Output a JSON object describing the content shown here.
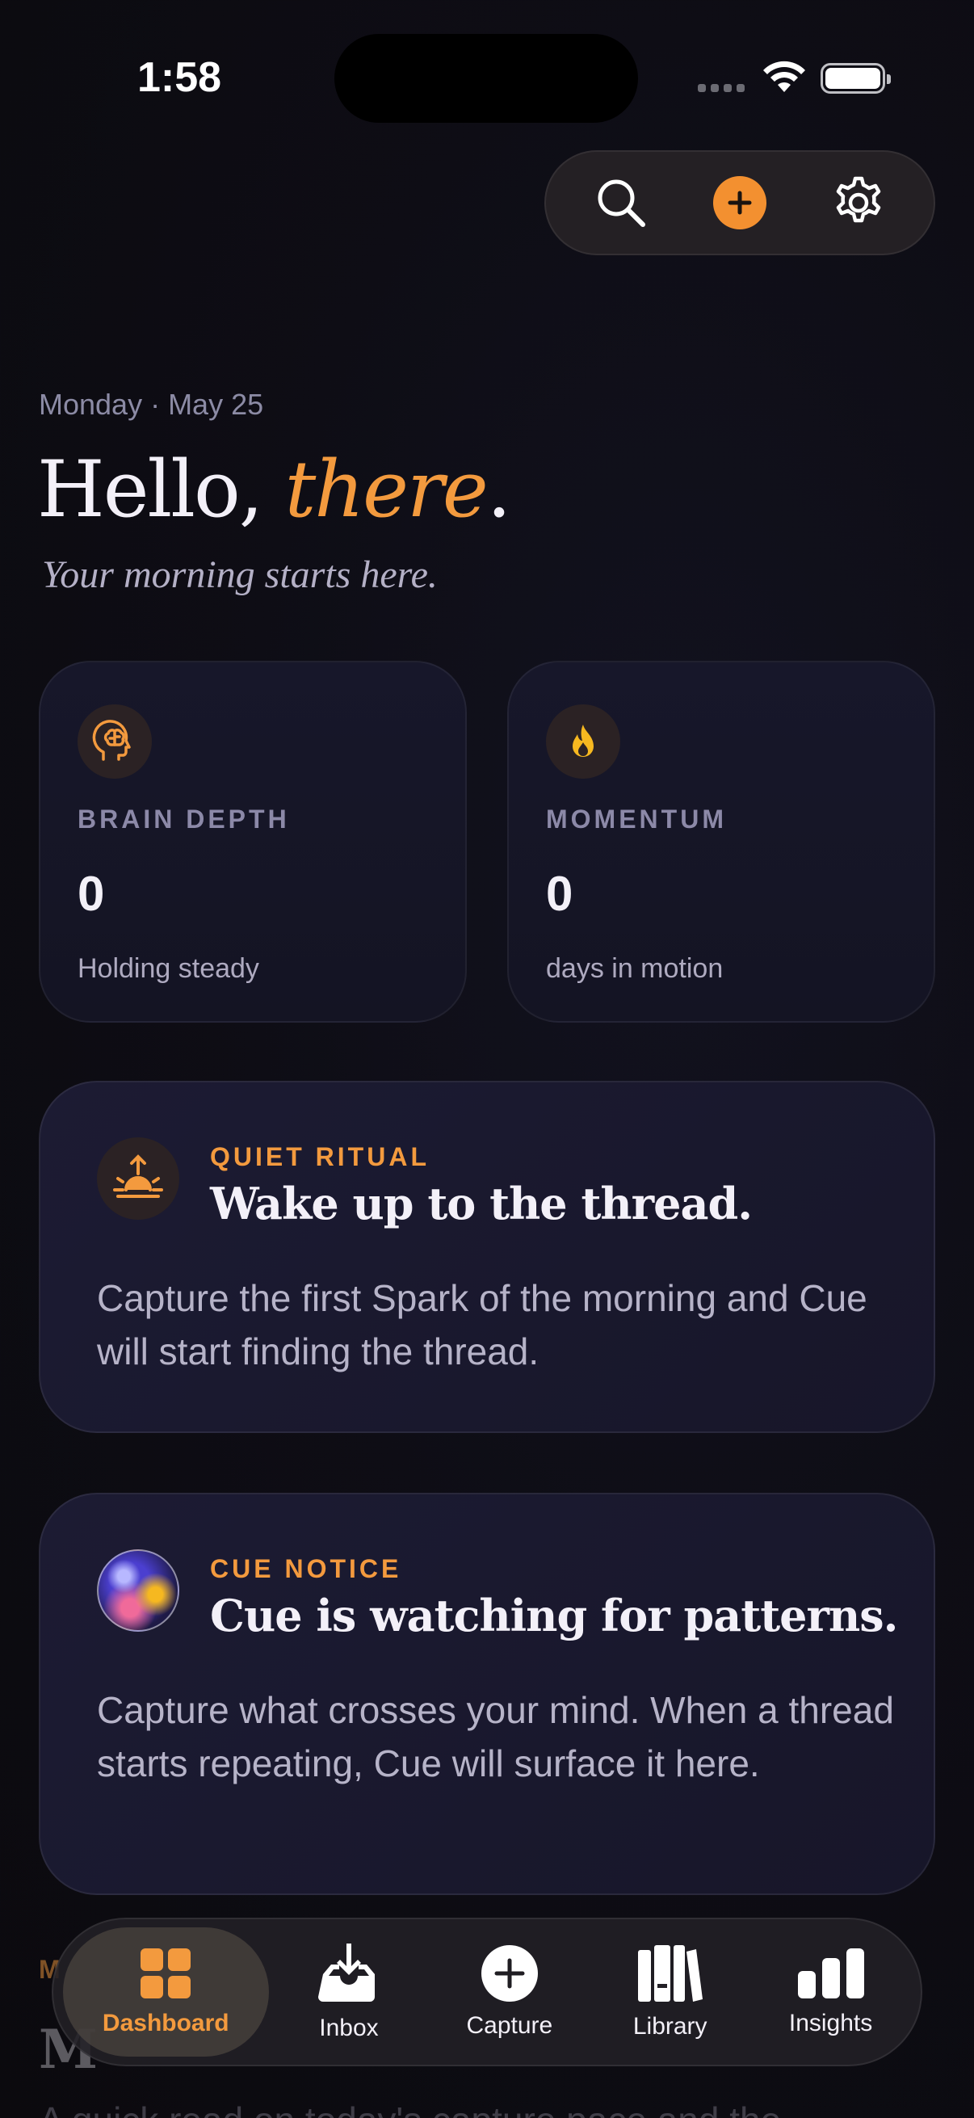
{
  "status": {
    "time": "1:58"
  },
  "toolbar": {
    "search_icon": "search-icon",
    "add_icon": "plus-icon",
    "settings_icon": "gear-icon"
  },
  "header": {
    "date": "Monday · May 25",
    "greeting_prefix": "Hello, ",
    "greeting_name": "there",
    "greeting_suffix": ".",
    "subtitle": "Your morning starts here."
  },
  "stats": [
    {
      "icon": "brain-icon",
      "label": "BRAIN DEPTH",
      "value": "0",
      "caption": "Holding steady"
    },
    {
      "icon": "flame-icon",
      "label": "MOMENTUM",
      "value": "0",
      "caption": "days in motion"
    }
  ],
  "ritual_card": {
    "icon": "sunrise-icon",
    "kicker": "QUIET RITUAL",
    "title": "Wake up to the thread.",
    "body": "Capture the first Spark of the morning and Cue will start finding the thread."
  },
  "notice_card": {
    "icon": "cue-orb",
    "kicker": "CUE NOTICE",
    "title": "Cue is watching for patterns.",
    "body": "Capture what crosses your mind. When a thread starts repeating, Cue will surface it here."
  },
  "partially_hidden": {
    "kicker": "M",
    "title": "M",
    "subtitle": "A quick read on today's capture pace and the"
  },
  "tabs": [
    {
      "label": "Dashboard",
      "icon": "grid-icon",
      "active": true
    },
    {
      "label": "Inbox",
      "icon": "inbox-icon",
      "active": false
    },
    {
      "label": "Capture",
      "icon": "plus-circle-icon",
      "active": false
    },
    {
      "label": "Library",
      "icon": "books-icon",
      "active": false
    },
    {
      "label": "Insights",
      "icon": "bar-chart-icon",
      "active": false
    }
  ],
  "colors": {
    "accent": "#f39a3e",
    "background": "#0d0c12",
    "card": "#1c1b33"
  }
}
